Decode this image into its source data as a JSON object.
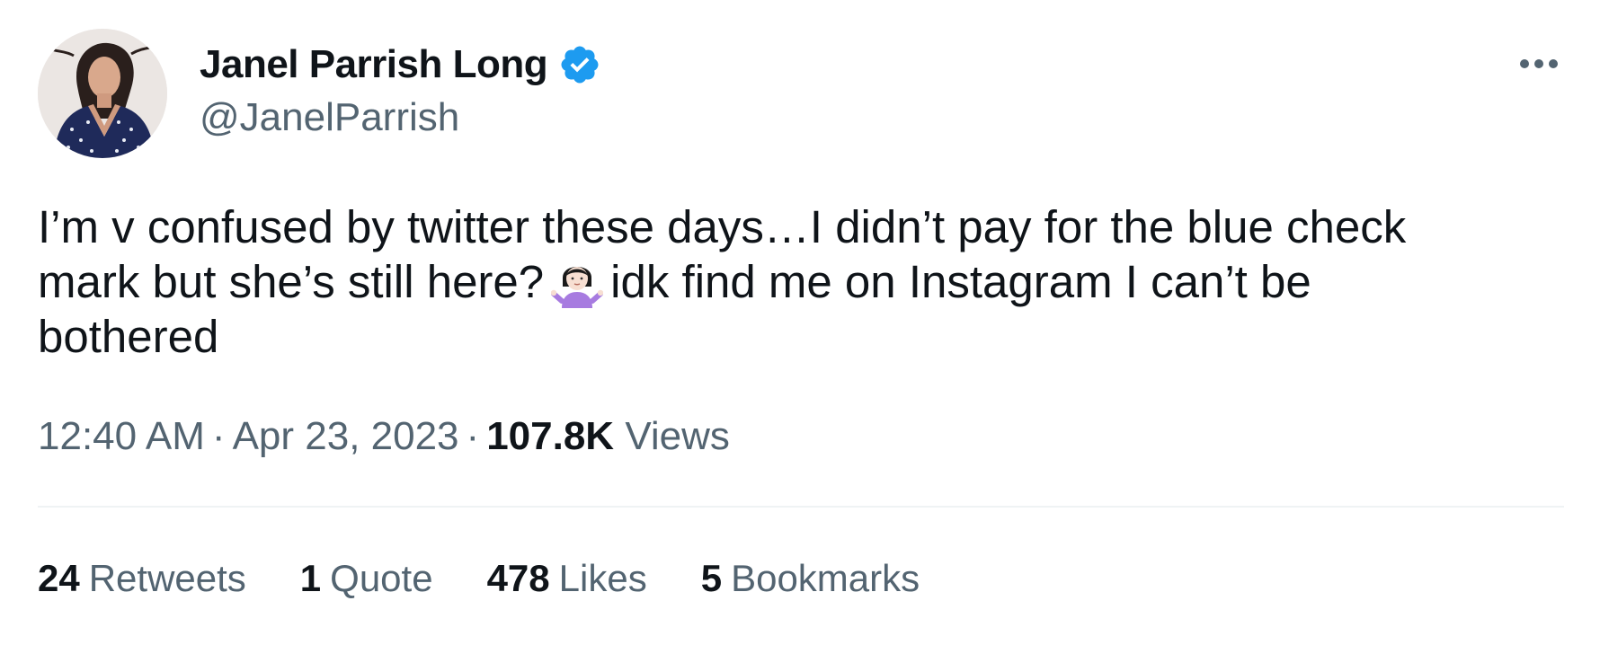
{
  "author": {
    "display_name": "Janel Parrish Long",
    "handle": "@JanelParrish",
    "verified": true,
    "verified_color": "#1d9bf0",
    "avatar_icon": "profile-photo"
  },
  "more_icon": "ellipsis-icon",
  "tweet": {
    "text_line_1": "I’m v confused by twitter these days…I didn’t pay for the blue check",
    "text_line_2": "mark but she’s still here?",
    "emoji": "person-shrugging-emoji",
    "text_line_2_after": "idk find me on Instagram I can’t be",
    "text_line_3": "bothered"
  },
  "meta": {
    "time": "12:40 AM",
    "separator": "·",
    "date": "Apr 23, 2023",
    "views_count": "107.8K",
    "views_label": "Views"
  },
  "stats": {
    "retweets_count": "24",
    "retweets_label": "Retweets",
    "quotes_count": "1",
    "quotes_label": "Quote",
    "likes_count": "478",
    "likes_label": "Likes",
    "bookmarks_count": "5",
    "bookmarks_label": "Bookmarks"
  },
  "colors": {
    "text_primary": "#0f1419",
    "text_secondary": "#536471",
    "divider": "#eff3f4"
  }
}
